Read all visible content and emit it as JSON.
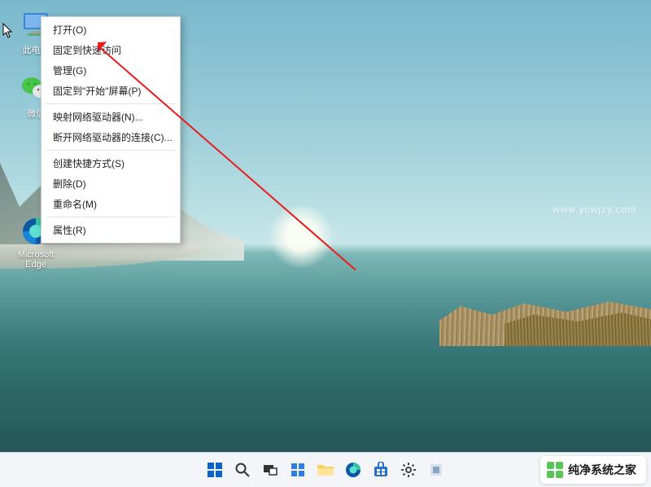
{
  "desktop_icons": {
    "this_pc": "此电脑",
    "wechat": "微信",
    "edge": "Microsoft\nEdge"
  },
  "context_menu": {
    "open": "打开(O)",
    "pin_quick": "固定到快速访问",
    "manage": "管理(G)",
    "pin_start": "固定到\"开始\"屏幕(P)",
    "map_net": "映射网络驱动器(N)...",
    "disconnect_net": "断开网络驱动器的连接(C)...",
    "shortcut": "创建快捷方式(S)",
    "delete": "删除(D)",
    "rename": "重命名(M)",
    "properties": "属性(R)"
  },
  "watermark": "www.ycwjzy.com",
  "brand": "纯净系统之家",
  "taskbar": {
    "start": "start-icon",
    "search": "search-icon",
    "taskview": "taskview-icon",
    "widgets": "widgets-icon",
    "explorer": "file-explorer-icon",
    "edge": "edge-icon",
    "store": "store-icon",
    "settings": "settings-icon",
    "app": "app-icon"
  }
}
